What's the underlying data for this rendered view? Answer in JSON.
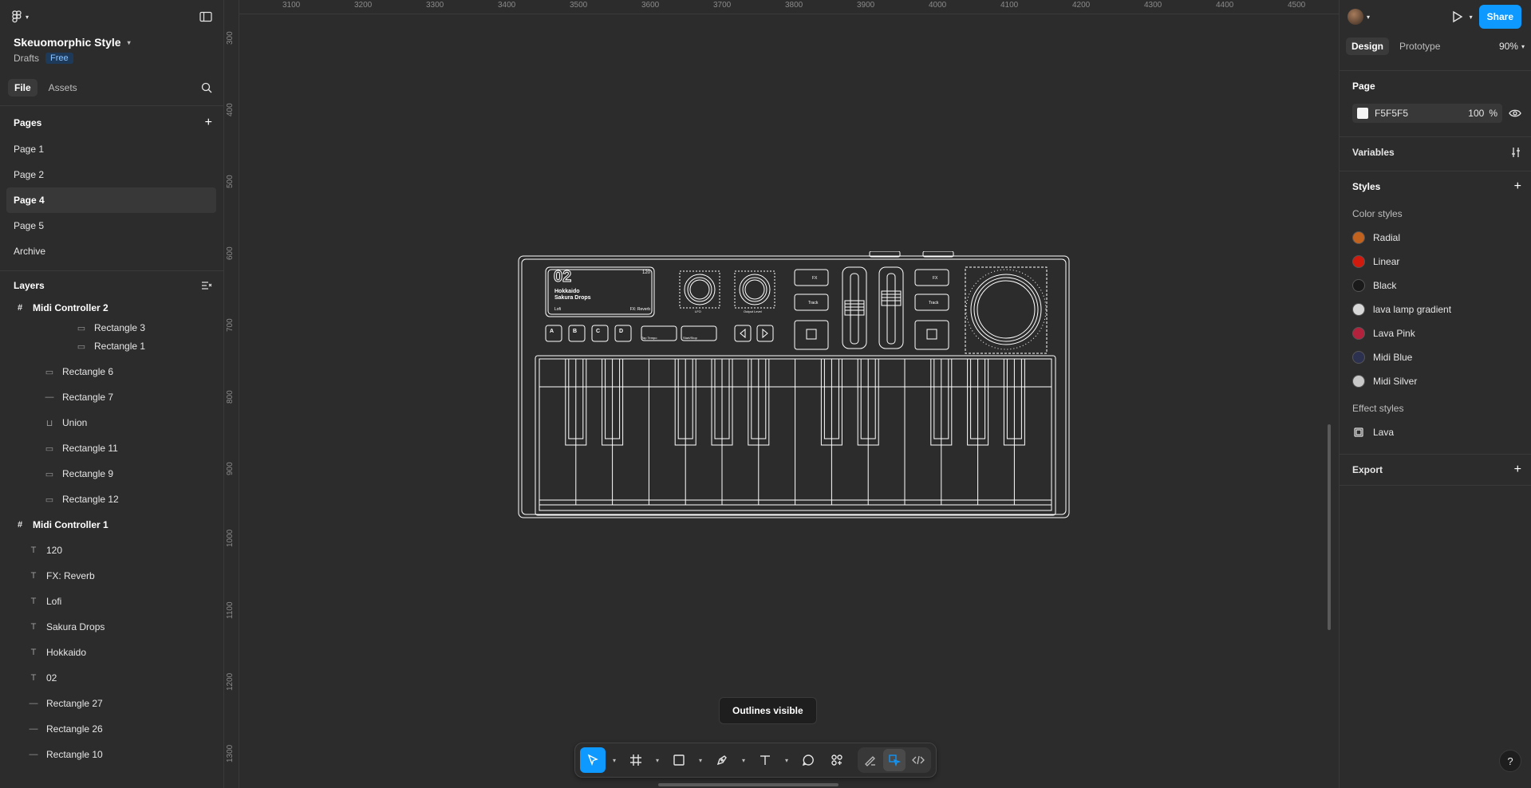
{
  "file": {
    "name": "Skeuomorphic Style",
    "location": "Drafts",
    "plan_badge": "Free"
  },
  "left_tabs": {
    "file": "File",
    "assets": "Assets"
  },
  "pages": {
    "title": "Pages",
    "items": [
      "Page 1",
      "Page 2",
      "Page 4",
      "Page 5",
      "Archive"
    ],
    "active_index": 2
  },
  "layers": {
    "title": "Layers",
    "items": [
      {
        "label": "Midi Controller 2",
        "type": "frame"
      },
      {
        "label": "Rectangle 3",
        "type": "rect"
      },
      {
        "label": "Rectangle 1",
        "type": "rect"
      },
      {
        "label": "Rectangle 6",
        "type": "rect"
      },
      {
        "label": "Rectangle 7",
        "type": "line"
      },
      {
        "label": "Union",
        "type": "union"
      },
      {
        "label": "Rectangle 11",
        "type": "rect"
      },
      {
        "label": "Rectangle 9",
        "type": "rect"
      },
      {
        "label": "Rectangle 12",
        "type": "rect"
      },
      {
        "label": "Midi Controller 1",
        "type": "frame"
      },
      {
        "label": "120",
        "type": "text"
      },
      {
        "label": "FX: Reverb",
        "type": "text"
      },
      {
        "label": "Lofi",
        "type": "text"
      },
      {
        "label": "Sakura Drops",
        "type": "text"
      },
      {
        "label": "Hokkaido",
        "type": "text"
      },
      {
        "label": "02",
        "type": "text"
      },
      {
        "label": "Rectangle 27",
        "type": "line"
      },
      {
        "label": "Rectangle 26",
        "type": "line"
      },
      {
        "label": "Rectangle 10",
        "type": "line"
      }
    ]
  },
  "ruler": {
    "x_ticks": [
      "3100",
      "3200",
      "3300",
      "3400",
      "3500",
      "3600",
      "3700",
      "3800",
      "3900",
      "4000",
      "4100",
      "4200",
      "4300",
      "4400",
      "4500"
    ],
    "y_ticks": [
      "300",
      "400",
      "500",
      "600",
      "700",
      "800",
      "900",
      "1000",
      "1100",
      "1200",
      "1300"
    ]
  },
  "device": {
    "display_number": "02",
    "display_tempo": "120",
    "display_line1": "Hokkaido",
    "display_line2": "Sakura Drops",
    "display_left": "Lofi",
    "display_right": "FX: Reverb",
    "pads": [
      "A",
      "B",
      "C",
      "D"
    ],
    "btn_tap": "Tap Tempo",
    "btn_start": "Start/Stop",
    "knob1": "LFO",
    "knob2": "Output Level",
    "fx_label": "FX",
    "track_label": "Track"
  },
  "tooltip": "Outlines visible",
  "header": {
    "share": "Share",
    "tab_design": "Design",
    "tab_prototype": "Prototype",
    "zoom": "90%"
  },
  "page_panel": {
    "title": "Page",
    "fill_hex": "F5F5F5",
    "fill_opacity": "100",
    "pct": "%"
  },
  "variables": {
    "title": "Variables"
  },
  "styles": {
    "title": "Styles",
    "color_title": "Color styles",
    "colors": [
      {
        "name": "Radial",
        "swatch": "#c2621f"
      },
      {
        "name": "Linear",
        "swatch": "#d11a0e"
      },
      {
        "name": "Black",
        "swatch": "#1a1a1a"
      },
      {
        "name": "lava lamp gradient",
        "swatch": "#d8d8d8"
      },
      {
        "name": "Lava Pink",
        "swatch": "#b3223c"
      },
      {
        "name": "Midi Blue",
        "swatch": "#2d3150"
      },
      {
        "name": "Midi Silver",
        "swatch": "#c9c9c9"
      }
    ],
    "effect_title": "Effect styles",
    "effects": [
      {
        "name": "Lava"
      }
    ]
  },
  "export": {
    "title": "Export"
  },
  "help": "?"
}
